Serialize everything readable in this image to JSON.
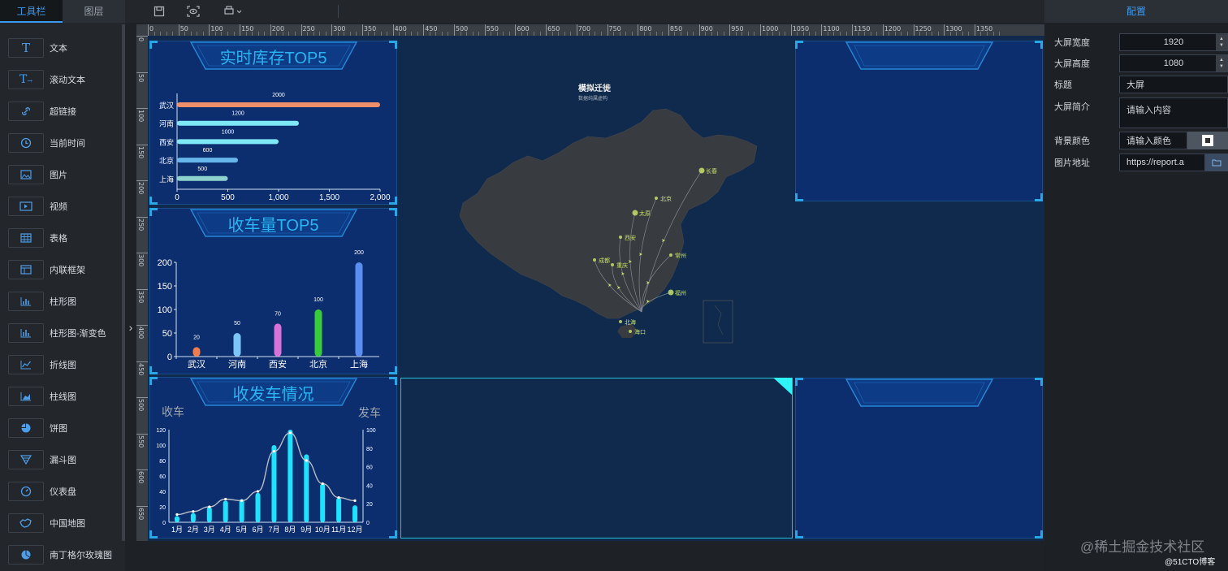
{
  "left_panel": {
    "tabs": [
      {
        "label": "工具栏",
        "active": true
      },
      {
        "label": "图层",
        "active": false
      }
    ],
    "tools": [
      {
        "label": "文本",
        "icon": "text-icon"
      },
      {
        "label": "滚动文本",
        "icon": "scroll-text-icon"
      },
      {
        "label": "超链接",
        "icon": "link-icon"
      },
      {
        "label": "当前时间",
        "icon": "clock-icon"
      },
      {
        "label": "图片",
        "icon": "image-icon"
      },
      {
        "label": "视频",
        "icon": "video-icon"
      },
      {
        "label": "表格",
        "icon": "table-icon"
      },
      {
        "label": "内联框架",
        "icon": "iframe-icon"
      },
      {
        "label": "柱形图",
        "icon": "bar-chart-icon"
      },
      {
        "label": "柱形图-渐变色",
        "icon": "bar-chart-gradient-icon"
      },
      {
        "label": "折线图",
        "icon": "line-chart-icon"
      },
      {
        "label": "柱线图",
        "icon": "bar-line-chart-icon"
      },
      {
        "label": "饼图",
        "icon": "pie-chart-icon"
      },
      {
        "label": "漏斗图",
        "icon": "funnel-icon"
      },
      {
        "label": "仪表盘",
        "icon": "gauge-icon"
      },
      {
        "label": "中国地图",
        "icon": "china-map-icon"
      },
      {
        "label": "南丁格尔玫瑰图",
        "icon": "rose-chart-icon"
      }
    ]
  },
  "toolbar": {
    "buttons": [
      "save-icon",
      "preview-icon",
      "stamp-icon"
    ]
  },
  "ruler": {
    "top_labels": [
      "0",
      "50",
      "100",
      "150",
      "200",
      "250",
      "300",
      "350",
      "400",
      "450",
      "500",
      "550",
      "600",
      "650",
      "700",
      "750",
      "800",
      "850",
      "900",
      "950",
      "1000",
      "1050",
      "1100",
      "1150",
      "1200",
      "1250",
      "1300",
      "1350"
    ],
    "left_labels": [
      "0",
      "50",
      "100",
      "150",
      "200",
      "250",
      "300",
      "350",
      "400",
      "450",
      "500",
      "550",
      "600",
      "650",
      "700"
    ]
  },
  "colors": {
    "accent": "#3a9af0",
    "panel_bg": "#0c2e6f",
    "canvas_bg": "#0f2a4c",
    "title_cyan": "#29b5f1",
    "bar_cyan": "#1ee3ff",
    "map_land": "#383b40",
    "route_yellow": "#c7e06b"
  },
  "panels": {
    "stock": {
      "title": "实时库存TOP5"
    },
    "receive": {
      "title": "收车量TOP5"
    },
    "dispatch": {
      "title": "收发车情况",
      "left_axis_name": "收车",
      "right_axis_name": "发车"
    },
    "map": {
      "title": "模拟迁徙",
      "subtitle": "数据纯属虚构",
      "cities": [
        "长春",
        "北京",
        "太原",
        "西安",
        "成都",
        "重庆",
        "常州",
        "福州",
        "北海",
        "海口"
      ]
    }
  },
  "chart_data": [
    {
      "id": "stock",
      "type": "bar",
      "orientation": "horizontal",
      "title": "实时库存TOP5",
      "categories": [
        "武汉",
        "河南",
        "西安",
        "北京",
        "上海"
      ],
      "values": [
        2000,
        1200,
        1000,
        600,
        500
      ],
      "xlim": [
        0,
        2000
      ],
      "x_ticks": [
        "0",
        "500",
        "1,000",
        "1,500",
        "2,000"
      ],
      "colors": [
        "#f0906a",
        "#7ee8f6",
        "#7ee8f6",
        "#67b6ea",
        "#8ed2cf"
      ]
    },
    {
      "id": "receive",
      "type": "bar",
      "title": "收车量TOP5",
      "categories": [
        "武汉",
        "河南",
        "西安",
        "北京",
        "上海"
      ],
      "values": [
        20,
        50,
        70,
        100,
        200
      ],
      "ylim": [
        0,
        200
      ],
      "y_ticks": [
        "0",
        "50",
        "100",
        "150",
        "200"
      ],
      "colors": [
        "#f07c4b",
        "#7cc6f5",
        "#d672d8",
        "#38cc3d",
        "#5a8ef0"
      ]
    },
    {
      "id": "dispatch",
      "type": "bar+line",
      "title": "收发车情况",
      "categories": [
        "1月",
        "2月",
        "3月",
        "4月",
        "5月",
        "6月",
        "7月",
        "8月",
        "9月",
        "10月",
        "11月",
        "12月"
      ],
      "series": [
        {
          "name": "收车",
          "type": "bar",
          "values": [
            8,
            12,
            20,
            28,
            30,
            38,
            100,
            120,
            88,
            50,
            32,
            22
          ]
        },
        {
          "name": "发车",
          "type": "line",
          "values": [
            10,
            14,
            20,
            30,
            28,
            40,
            92,
            116,
            80,
            50,
            32,
            28
          ]
        }
      ],
      "ylim_left": [
        0,
        120
      ],
      "y_ticks_left": [
        "0",
        "20",
        "40",
        "60",
        "80",
        "100",
        "120"
      ],
      "ylim_right": [
        0,
        100
      ],
      "y_ticks_right": [
        "0",
        "20",
        "40",
        "60",
        "80",
        "100"
      ]
    }
  ],
  "config": {
    "tab": "配置",
    "fields": [
      {
        "label": "大屏宽度",
        "value": "1920",
        "type": "number"
      },
      {
        "label": "大屏高度",
        "value": "1080",
        "type": "number"
      },
      {
        "label": "标题",
        "value": "大屏",
        "type": "text"
      },
      {
        "label": "大屏简介",
        "placeholder": "请输入内容",
        "type": "textarea"
      },
      {
        "label": "背景颜色",
        "placeholder": "请输入颜色",
        "type": "color"
      },
      {
        "label": "图片地址",
        "value": "https://report.a",
        "type": "file"
      }
    ]
  },
  "watermark": {
    "line1": "@稀土掘金技术社区",
    "line2": "@51CTO博客"
  }
}
